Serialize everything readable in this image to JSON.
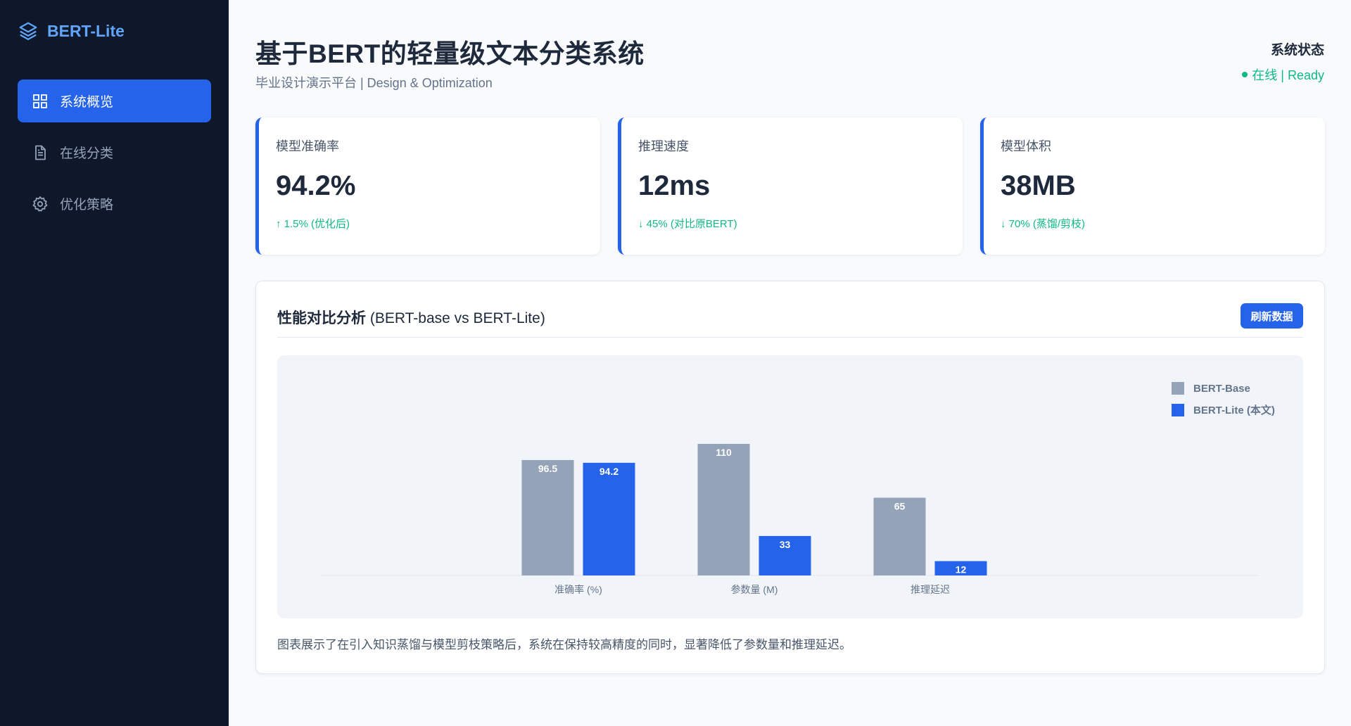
{
  "app": {
    "brand": "BERT-Lite"
  },
  "sidebar": {
    "items": [
      {
        "label": "系统概览",
        "icon": "grid-icon",
        "active": true
      },
      {
        "label": "在线分类",
        "icon": "document-icon",
        "active": false
      },
      {
        "label": "优化策略",
        "icon": "gear-icon",
        "active": false
      }
    ]
  },
  "header": {
    "title": "基于BERT的轻量级文本分类系统",
    "subtitle": "毕业设计演示平台 | Design & Optimization",
    "status_label": "系统状态",
    "status_value": "在线 | Ready"
  },
  "stats": [
    {
      "label": "模型准确率",
      "value": "94.2%",
      "delta": "↑ 1.5% (优化后)"
    },
    {
      "label": "推理速度",
      "value": "12ms",
      "delta": "↓ 45% (对比原BERT)"
    },
    {
      "label": "模型体积",
      "value": "38MB",
      "delta": "↓ 70% (蒸馏/剪枝)"
    }
  ],
  "panel": {
    "title_bold": "性能对比分析",
    "title_rest": " (BERT-base vs BERT-Lite)",
    "refresh_label": "刷新数据",
    "caption": "图表展示了在引入知识蒸馏与模型剪枝策略后，系统在保持较高精度的同时，显著降低了参数量和推理延迟。"
  },
  "colors": {
    "accent": "#2563eb",
    "base_series": "#94a3b8",
    "positive": "#10b981",
    "sidebar_bg": "#0f172a"
  },
  "chart_data": {
    "type": "bar",
    "categories": [
      "准确率 (%)",
      "参数量 (M)",
      "推理延迟"
    ],
    "series": [
      {
        "name": "BERT-Base",
        "values": [
          96.5,
          110,
          65
        ],
        "color": "#94a3b8"
      },
      {
        "name": "BERT-Lite (本文)",
        "values": [
          94.2,
          33,
          12
        ],
        "color": "#2563eb"
      }
    ],
    "legend": "top-right",
    "grid": false,
    "data_labels": true
  }
}
